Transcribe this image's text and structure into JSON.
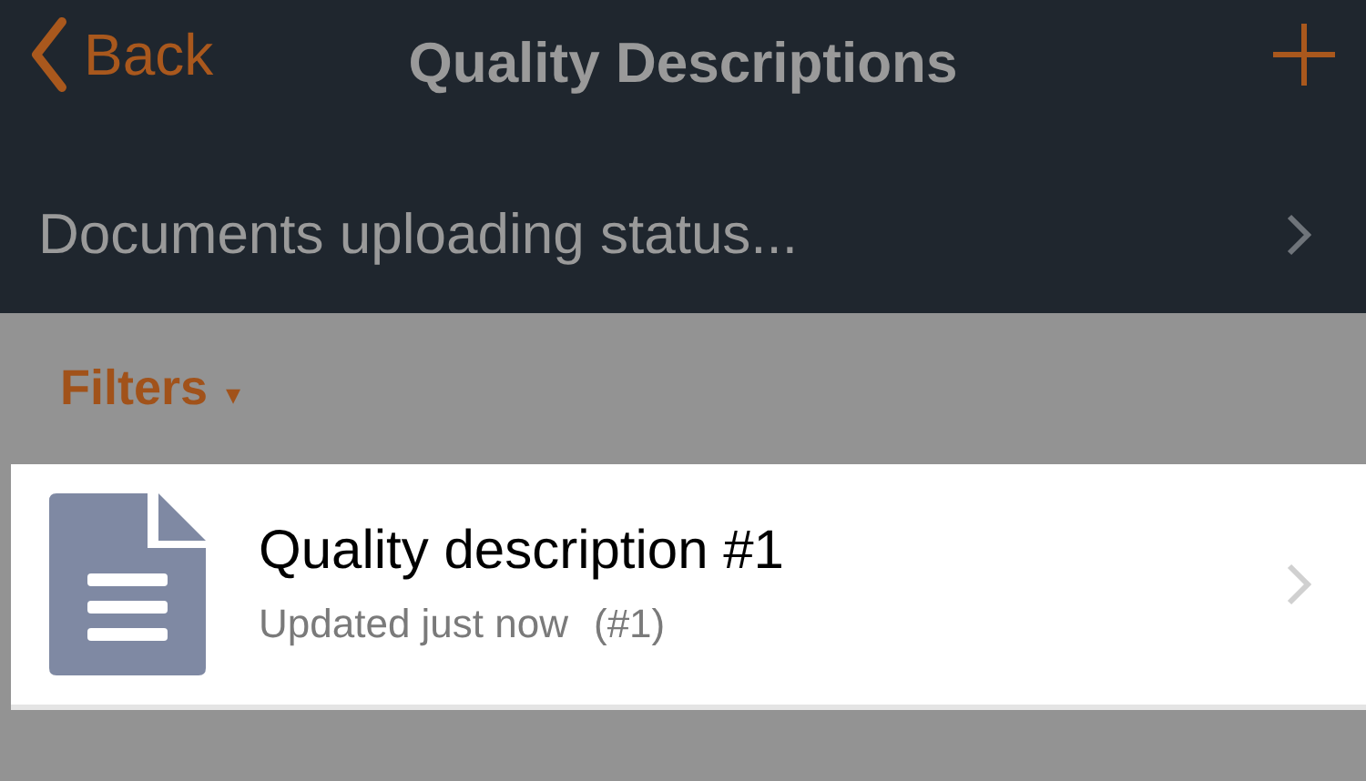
{
  "nav_bar": {
    "back": "Back",
    "title": "Quality Descriptions"
  },
  "upload_status": {
    "label": "Documents uploading status..."
  },
  "filters": {
    "label": "Filters",
    "caret": "▾"
  },
  "documents": [
    {
      "title": "Quality description #1",
      "updated": "Updated just now",
      "number": "(#1)"
    }
  ]
}
